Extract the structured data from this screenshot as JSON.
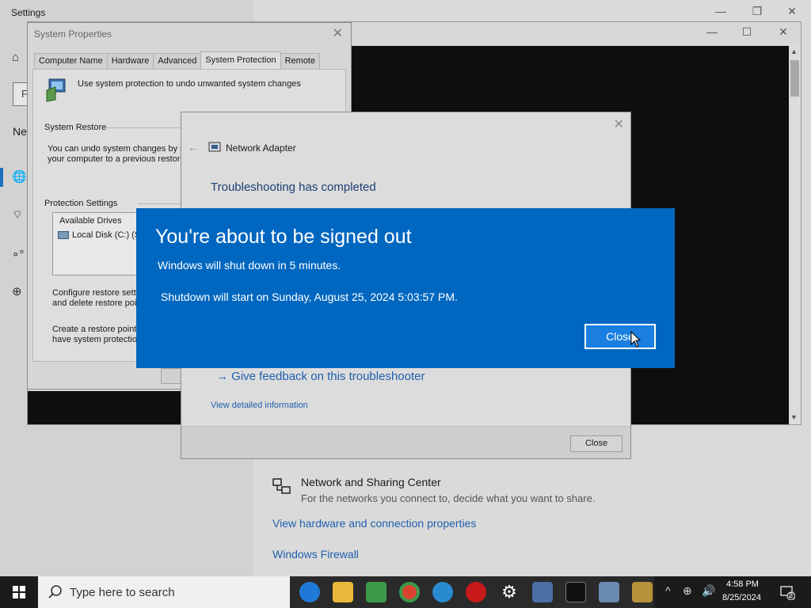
{
  "settings": {
    "title": "Settings",
    "search_glyph": "F",
    "ne_text": "Ne",
    "network_sharing": {
      "title": "Network and Sharing Center",
      "description": "For the networks you connect to, decide what you want to share."
    },
    "links": [
      "View hardware and connection properties",
      "Windows Firewall"
    ]
  },
  "system_properties": {
    "title": "System Properties",
    "tabs": [
      "Computer Name",
      "Hardware",
      "Advanced",
      "System Protection",
      "Remote"
    ],
    "active_tab": "System Protection",
    "intro": "Use system protection to undo unwanted system changes",
    "system_restore_heading": "System Restore",
    "system_restore_text_1": "You can undo system changes by re",
    "system_restore_text_2": "your computer to a previous restore",
    "protection_heading": "Protection Settings",
    "drives_header": "Available Drives",
    "drive_item": "Local Disk (C:) (Sy",
    "configure_text_1": "Configure restore settin",
    "configure_text_2": "and delete restore poin",
    "create_text_1": "Create a restore point r",
    "create_text_2": "have system protection"
  },
  "troubleshooter": {
    "title": "Network Adapter",
    "heading": "Troubleshooting has completed",
    "feedback_link": "Give feedback on this troubleshooter",
    "detailed_link": "View detailed information",
    "close_label": "Close"
  },
  "signout_dialog": {
    "title": "You're about to be signed out",
    "line1": "Windows will shut down in 5 minutes.",
    "line2": "Shutdown will start on Sunday, August 25, 2024 5:03:57 PM.",
    "close_label": "Close",
    "background_color": "#0067c0"
  },
  "taskbar": {
    "search_placeholder": "Type here to search",
    "time": "4:58 PM",
    "date": "8/25/2024",
    "notification_count": "2",
    "apps": [
      "safari-like-icon",
      "file-explorer-icon",
      "store-icon",
      "chrome-icon",
      "edge-icon",
      "opera-icon",
      "settings-icon",
      "remote-desktop-icon",
      "terminal-icon",
      "control-panel-icon",
      "keys-icon"
    ]
  }
}
